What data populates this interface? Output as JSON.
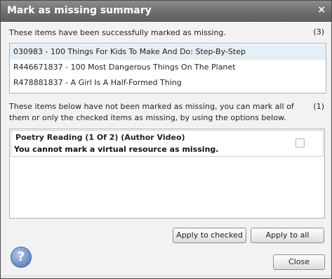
{
  "dialog": {
    "title": "Mark as missing summary",
    "close_glyph": "×"
  },
  "success": {
    "description": "These items have been successfully marked as missing.",
    "count": "(3)",
    "items": [
      {
        "label": "030983 - 100 Things For Kids To Make And Do: Step-By-Step"
      },
      {
        "label": "R446671837 - 100 Most Dangerous Things On The Planet"
      },
      {
        "label": "R478881837 - A Girl Is A Half-Formed Thing"
      }
    ]
  },
  "failed": {
    "description_line1": "These items below have not been marked as missing, you can mark all of",
    "description_line2": "them or only the checked items as missing, by using the options below.",
    "count": "(1)",
    "items": [
      {
        "title": "Poetry Reading (1 Of 2) (Author Video)",
        "message": "You cannot mark a virtual resource as missing.",
        "checked": false
      }
    ]
  },
  "buttons": {
    "apply_checked": "Apply to checked",
    "apply_all": "Apply to all",
    "close": "Close"
  },
  "help": {
    "glyph": "?",
    "icon": "help-icon"
  }
}
